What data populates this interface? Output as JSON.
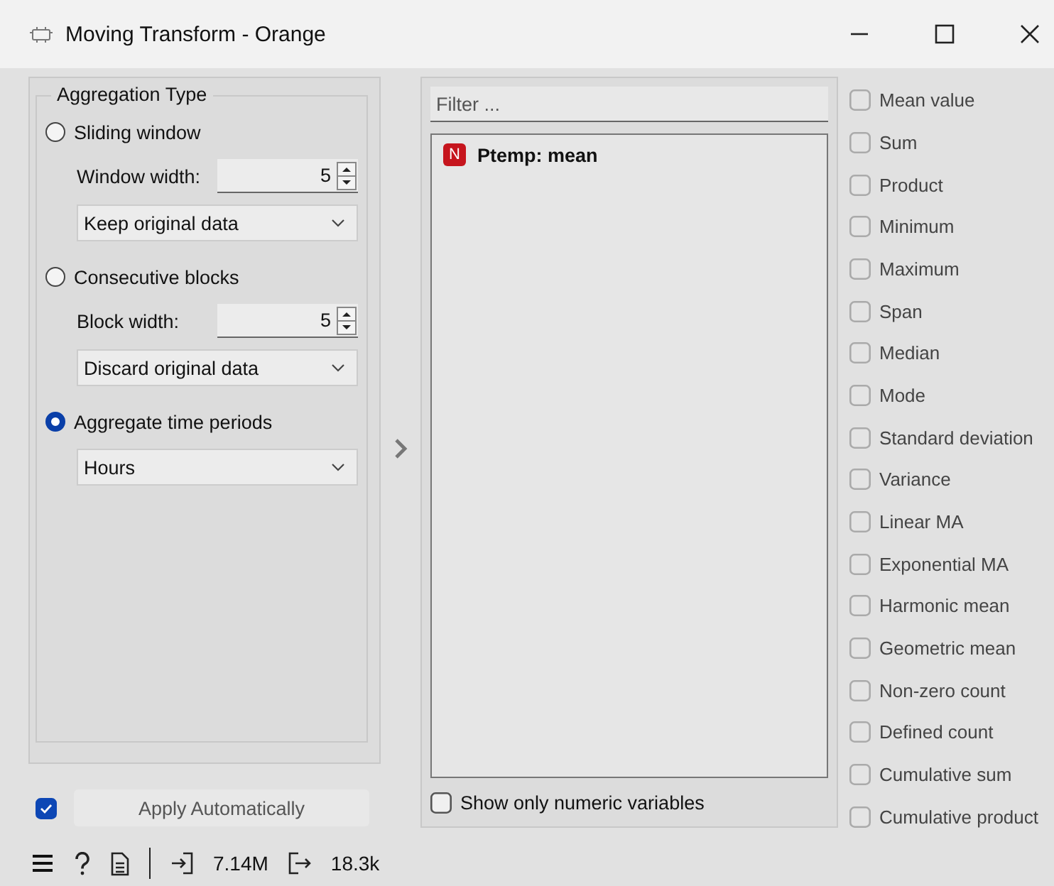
{
  "window": {
    "title": "Moving Transform - Orange"
  },
  "aggregation": {
    "title": "Aggregation Type",
    "options": [
      {
        "label": "Sliding window",
        "selected": false,
        "spin": {
          "label": "Window width:",
          "value": "5"
        },
        "dropdown": "Keep original data"
      },
      {
        "label": "Consecutive blocks",
        "selected": false,
        "spin": {
          "label": "Block width:",
          "value": "5"
        },
        "dropdown": "Discard original data"
      },
      {
        "label": "Aggregate time periods",
        "selected": true,
        "dropdown": "Hours"
      }
    ]
  },
  "apply": {
    "checked": true,
    "label": "Apply Automatically"
  },
  "filter": {
    "placeholder": "Filter ..."
  },
  "variables": [
    {
      "badge": "N",
      "label": "Ptemp: mean"
    }
  ],
  "show_numeric": {
    "label": "Show only numeric variables",
    "checked": false
  },
  "functions": [
    {
      "label": "Mean value",
      "checked": false
    },
    {
      "label": "Sum",
      "checked": false
    },
    {
      "label": "Product",
      "checked": false
    },
    {
      "label": "Minimum",
      "checked": false
    },
    {
      "label": "Maximum",
      "checked": false
    },
    {
      "label": "Span",
      "checked": false
    },
    {
      "label": "Median",
      "checked": false
    },
    {
      "label": "Mode",
      "checked": false
    },
    {
      "label": "Standard deviation",
      "checked": false
    },
    {
      "label": "Variance",
      "checked": false
    },
    {
      "label": "Linear MA",
      "checked": false
    },
    {
      "label": "Exponential MA",
      "checked": false
    },
    {
      "label": "Harmonic mean",
      "checked": false
    },
    {
      "label": "Geometric mean",
      "checked": false
    },
    {
      "label": "Non-zero count",
      "checked": false
    },
    {
      "label": "Defined count",
      "checked": false
    },
    {
      "label": "Cumulative sum",
      "checked": false
    },
    {
      "label": "Cumulative product",
      "checked": false
    }
  ],
  "status_bar": {
    "input": "7.14M",
    "output": "18.3k"
  }
}
